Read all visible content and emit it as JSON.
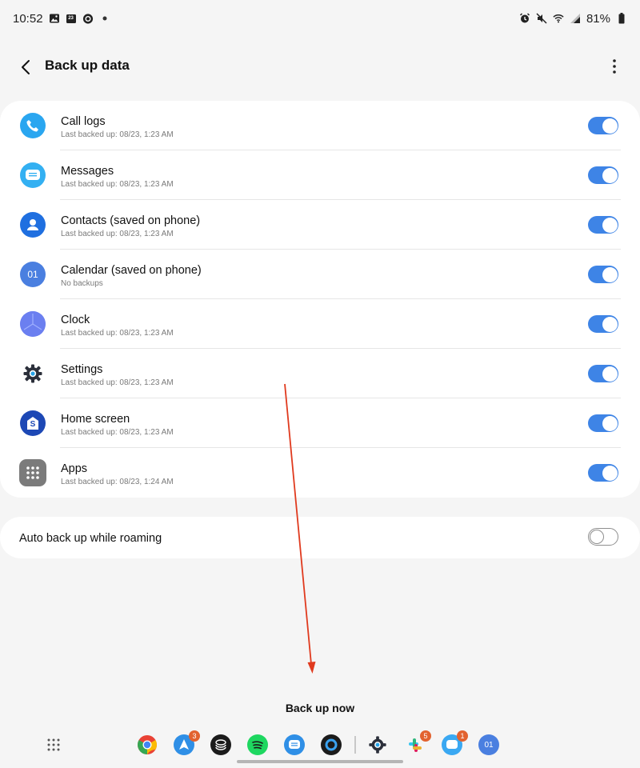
{
  "status_bar": {
    "time": "10:52",
    "calendar_day": "23",
    "battery": "81%",
    "left_icons": [
      "gallery-icon",
      "calendar-icon",
      "record-icon",
      "dot-icon"
    ],
    "right_icons": [
      "alarm-icon",
      "mute-icon",
      "wifi-icon",
      "signal-icon",
      "battery-icon"
    ]
  },
  "header": {
    "title": "Back up data",
    "back_icon": "chevron-left-icon",
    "more_icon": "more-vert-icon"
  },
  "items": [
    {
      "title": "Call logs",
      "subtitle": "Last backed up: 08/23, 1:23 AM",
      "icon": "phone-icon",
      "enabled": true,
      "color": "#2aa6f0"
    },
    {
      "title": "Messages",
      "subtitle": "Last backed up: 08/23, 1:23 AM",
      "icon": "messages-icon",
      "enabled": true,
      "color": "#33b0f2"
    },
    {
      "title": "Contacts (saved on phone)",
      "subtitle": "Last backed up: 08/23, 1:23 AM",
      "icon": "contacts-icon",
      "enabled": true,
      "color": "#1f6fe0"
    },
    {
      "title": "Calendar (saved on phone)",
      "subtitle": "No backups",
      "icon": "calendar-icon",
      "enabled": true,
      "color": "#4a7fe0",
      "icon_text": "01"
    },
    {
      "title": "Clock",
      "subtitle": "Last backed up: 08/23, 1:23 AM",
      "icon": "clock-icon",
      "enabled": true,
      "color": "#6b7ff0"
    },
    {
      "title": "Settings",
      "subtitle": "Last backed up: 08/23, 1:23 AM",
      "icon": "gear-icon",
      "enabled": true,
      "color": "#2b2f3a"
    },
    {
      "title": "Home screen",
      "subtitle": "Last backed up: 08/23, 1:23 AM",
      "icon": "home-screen-icon",
      "enabled": true,
      "color": "#1d48b5",
      "icon_text": "S"
    },
    {
      "title": "Apps",
      "subtitle": "Last backed up: 08/23, 1:24 AM",
      "icon": "apps-grid-icon",
      "enabled": true,
      "color": "#7b7b7b"
    }
  ],
  "roaming": {
    "label": "Auto back up while roaming",
    "enabled": false
  },
  "backup_button": {
    "label": "Back up now"
  },
  "taskbar": {
    "apps": [
      {
        "name": "chrome-icon"
      },
      {
        "name": "navigation-icon",
        "badge": "3"
      },
      {
        "name": "stack-app-icon"
      },
      {
        "name": "spotify-icon"
      },
      {
        "name": "messages-app-icon"
      },
      {
        "name": "camera-app-icon"
      },
      {
        "name": "settings-app-icon"
      },
      {
        "name": "slack-icon",
        "badge": "5"
      },
      {
        "name": "chat-app-icon",
        "badge": "1"
      },
      {
        "name": "calendar-app-icon",
        "label": "01"
      }
    ]
  },
  "colors": {
    "accent": "#3e84e6",
    "annotation": "#e03a1e",
    "background": "#f5f5f5"
  }
}
